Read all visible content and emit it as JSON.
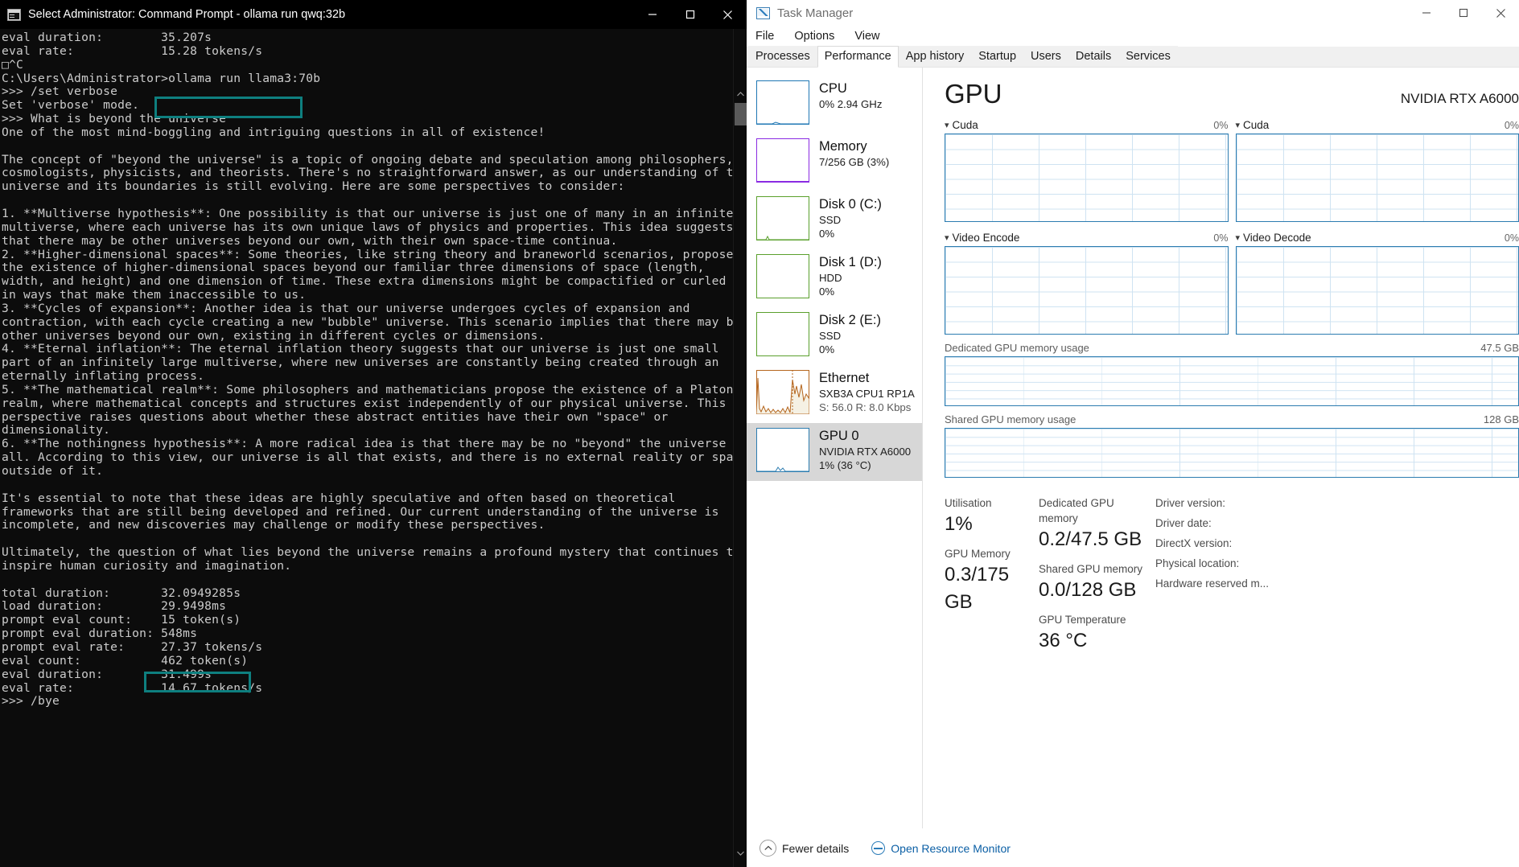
{
  "cmd": {
    "title": "Select Administrator: Command Prompt - ollama  run qwq:32b",
    "icon": "console-icon",
    "window_controls": {
      "minimize": "minimize-icon",
      "maximize": "maximize-icon",
      "close": "close-icon"
    },
    "terminal_text": "eval duration:        35.207s\neval rate:            15.28 tokens/s\n□^C\nC:\\Users\\Administrator>ollama run llama3:70b\n>>> /set verbose\nSet 'verbose' mode.\n>>> What is beyond the universe\nOne of the most mind-boggling and intriguing questions in all of existence!\n\nThe concept of \"beyond the universe\" is a topic of ongoing debate and speculation among philosophers,\ncosmologists, physicists, and theorists. There's no straightforward answer, as our understanding of the\nuniverse and its boundaries is still evolving. Here are some perspectives to consider:\n\n1. **Multiverse hypothesis**: One possibility is that our universe is just one of many in an infinite\nmultiverse, where each universe has its own unique laws of physics and properties. This idea suggests\nthat there may be other universes beyond our own, with their own space-time continua.\n2. **Higher-dimensional spaces**: Some theories, like string theory and braneworld scenarios, propose\nthe existence of higher-dimensional spaces beyond our familiar three dimensions of space (length,\nwidth, and height) and one dimension of time. These extra dimensions might be compactified or curled up\nin ways that make them inaccessible to us.\n3. **Cycles of expansion**: Another idea is that our universe undergoes cycles of expansion and\ncontraction, with each cycle creating a new \"bubble\" universe. This scenario implies that there may be\nother universes beyond our own, existing in different cycles or dimensions.\n4. **Eternal inflation**: The eternal inflation theory suggests that our universe is just one small\npart of an infinitely large multiverse, where new universes are constantly being created through an\neternally inflating process.\n5. **The mathematical realm**: Some philosophers and mathematicians propose the existence of a Platonic\nrealm, where mathematical concepts and structures exist independently of our physical universe. This\nperspective raises questions about whether these abstract entities have their own \"space\" or\ndimensionality.\n6. **The nothingness hypothesis**: A more radical idea is that there may be no \"beyond\" the universe at\nall. According to this view, our universe is all that exists, and there is no external reality or space\noutside of it.\n\nIt's essential to note that these ideas are highly speculative and often based on theoretical\nframeworks that are still being developed and refined. Our current understanding of the universe is\nincomplete, and new discoveries may challenge or modify these perspectives.\n\nUltimately, the question of what lies beyond the universe remains a profound mystery that continues to\ninspire human curiosity and imagination.\n\ntotal duration:       32.0949285s\nload duration:        29.9498ms\nprompt eval count:    15 token(s)\nprompt eval duration: 548ms\nprompt eval rate:     27.37 tokens/s\neval count:           462 token(s)\neval duration:        31.499s\neval rate:            14.67 tokens/s\n>>> /bye",
    "highlights": [
      {
        "name": "highlight-ollama-run-command",
        "text": "ollama run llama3:70b",
        "color": "#0e7f7f"
      },
      {
        "name": "highlight-eval-rate",
        "text": "14.67 tokens/s",
        "color": "#0e7f7f"
      }
    ],
    "scrollbar": {
      "up": "scroll-up-arrow",
      "down": "scroll-down-arrow"
    }
  },
  "taskmanager": {
    "title": "Task Manager",
    "window_controls": {
      "minimize": "minimize-icon",
      "maximize": "maximize-icon",
      "close": "close-icon"
    },
    "menu": [
      "File",
      "Options",
      "View"
    ],
    "tabs": [
      {
        "label": "Processes",
        "active": false
      },
      {
        "label": "Performance",
        "active": true
      },
      {
        "label": "App history",
        "active": false
      },
      {
        "label": "Startup",
        "active": false
      },
      {
        "label": "Users",
        "active": false
      },
      {
        "label": "Details",
        "active": false
      },
      {
        "label": "Services",
        "active": false
      }
    ],
    "sidebar": [
      {
        "name": "CPU",
        "sub1": "0% 2.94 GHz",
        "sub2": "",
        "color": "#1f77b4",
        "selected": false
      },
      {
        "name": "Memory",
        "sub1": "7/256 GB (3%)",
        "sub2": "",
        "color": "#8a2be2",
        "selected": false
      },
      {
        "name": "Disk 0 (C:)",
        "sub1": "SSD",
        "sub2": "0%",
        "color": "#5aa02c",
        "selected": false
      },
      {
        "name": "Disk 1 (D:)",
        "sub1": "HDD",
        "sub2": "0%",
        "color": "#5aa02c",
        "selected": false
      },
      {
        "name": "Disk 2 (E:)",
        "sub1": "SSD",
        "sub2": "0%",
        "color": "#5aa02c",
        "selected": false
      },
      {
        "name": "Ethernet",
        "sub1": "SXB3A CPU1 RP1A ...",
        "sub2": "S: 56.0 R: 8.0 Kbps",
        "color": "#b5651d",
        "selected": false
      },
      {
        "name": "GPU 0",
        "sub1": "NVIDIA RTX A6000",
        "sub2": "1%  (36 °C)",
        "color": "#2c7cb0",
        "selected": true
      }
    ],
    "gpu": {
      "title": "GPU",
      "model": "NVIDIA RTX A6000",
      "graphs": [
        {
          "label": "Cuda",
          "pct": "0%"
        },
        {
          "label": "Cuda",
          "pct": "0%"
        },
        {
          "label": "Video Encode",
          "pct": "0%"
        },
        {
          "label": "Video Decode",
          "pct": "0%"
        }
      ],
      "memory_graphs": [
        {
          "label": "Dedicated GPU memory usage",
          "right": "47.5 GB"
        },
        {
          "label": "Shared GPU memory usage",
          "right": "128 GB"
        }
      ],
      "stats": {
        "utilisation_label": "Utilisation",
        "utilisation_value": "1%",
        "gpu_memory_label": "GPU Memory",
        "gpu_memory_value": "0.3/175 GB",
        "dedicated_label": "Dedicated GPU memory",
        "dedicated_value": "0.2/47.5 GB",
        "shared_label": "Shared GPU memory",
        "shared_value": "0.0/128 GB",
        "temperature_label": "GPU Temperature",
        "temperature_value": "36 °C",
        "driver_version_label": "Driver version:",
        "driver_date_label": "Driver date:",
        "directx_label": "DirectX version:",
        "physical_location_label": "Physical location:",
        "hardware_reserved_label": "Hardware reserved m..."
      }
    },
    "footer": {
      "fewer_details": "Fewer details",
      "open_resource_monitor": "Open Resource Monitor",
      "fewer_icon": "chevron-up-circle-icon",
      "orm_icon": "resource-monitor-icon"
    }
  }
}
